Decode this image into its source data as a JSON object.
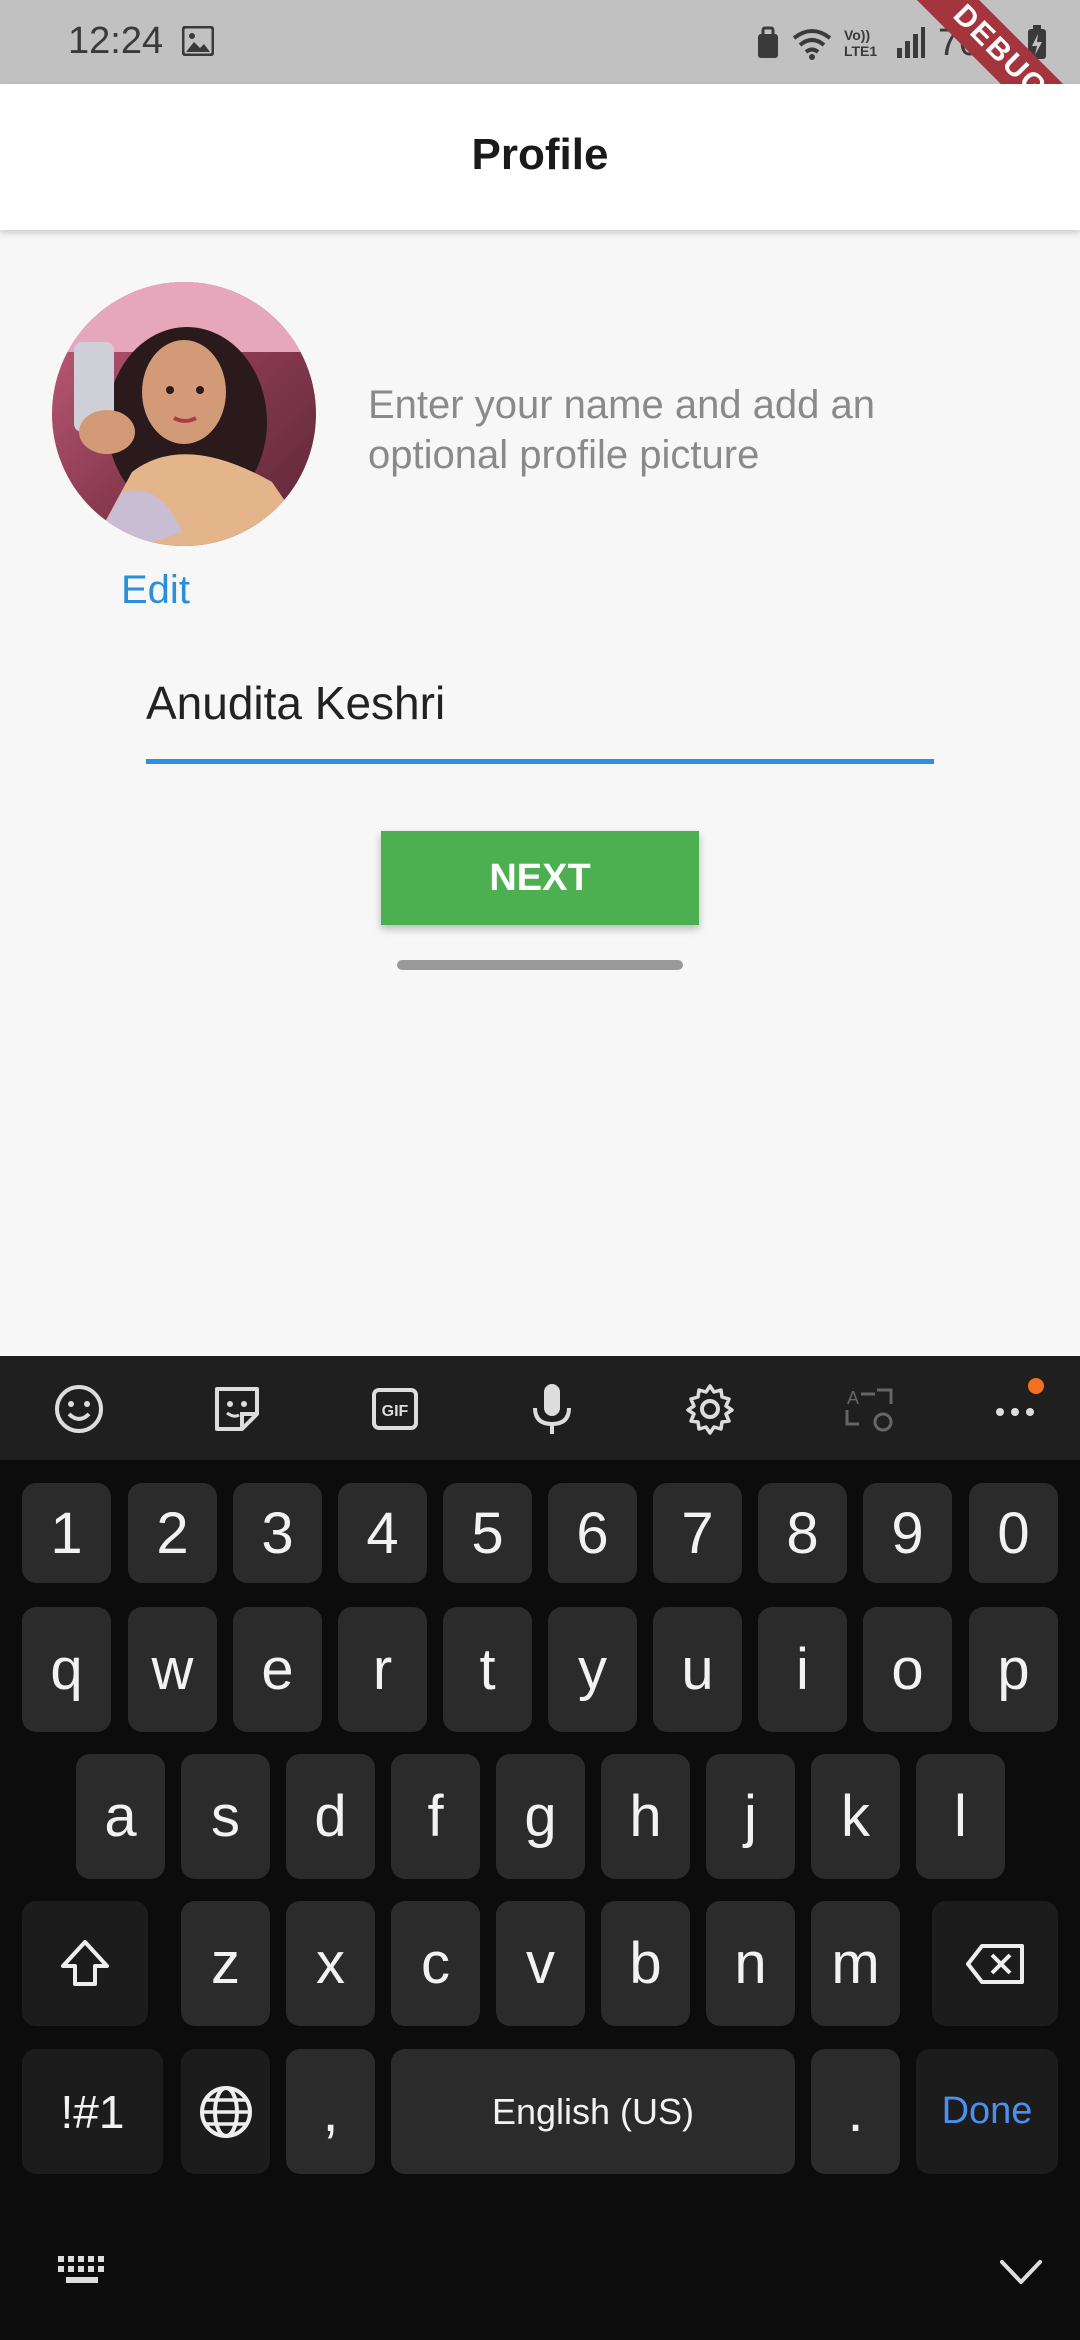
{
  "status_bar": {
    "time": "12:24",
    "battery": "70%",
    "network_label": "Vo)) LTE1",
    "debug_label": "DEBUG",
    "icons": [
      "gallery-icon",
      "bag-icon",
      "wifi-icon",
      "signal-icon",
      "battery-charging-icon"
    ]
  },
  "app_bar": {
    "title": "Profile"
  },
  "profile": {
    "edit_label": "Edit",
    "hint": "Enter your name and add an optional profile picture",
    "name_value": "Anudita Keshri",
    "next_label": "NEXT"
  },
  "keyboard": {
    "toolbar_icons": [
      "emoji-icon",
      "sticker-icon",
      "gif-icon",
      "microphone-icon",
      "settings-icon",
      "translate-icon",
      "more-icon"
    ],
    "gif_label": "GIF",
    "number_row": [
      "1",
      "2",
      "3",
      "4",
      "5",
      "6",
      "7",
      "8",
      "9",
      "0"
    ],
    "row_q": [
      "q",
      "w",
      "e",
      "r",
      "t",
      "y",
      "u",
      "i",
      "o",
      "p"
    ],
    "row_a": [
      "a",
      "s",
      "d",
      "f",
      "g",
      "h",
      "j",
      "k",
      "l"
    ],
    "row_z": [
      "z",
      "x",
      "c",
      "v",
      "b",
      "n",
      "m"
    ],
    "symbols_label": "!#1",
    "comma_label": ",",
    "space_label": "English (US)",
    "period_label": ".",
    "done_label": "Done"
  },
  "colors": {
    "accent_blue": "#2f8fe0",
    "next_green": "#4caf50",
    "done_blue": "#4a90f0",
    "notif_orange": "#f37021"
  }
}
